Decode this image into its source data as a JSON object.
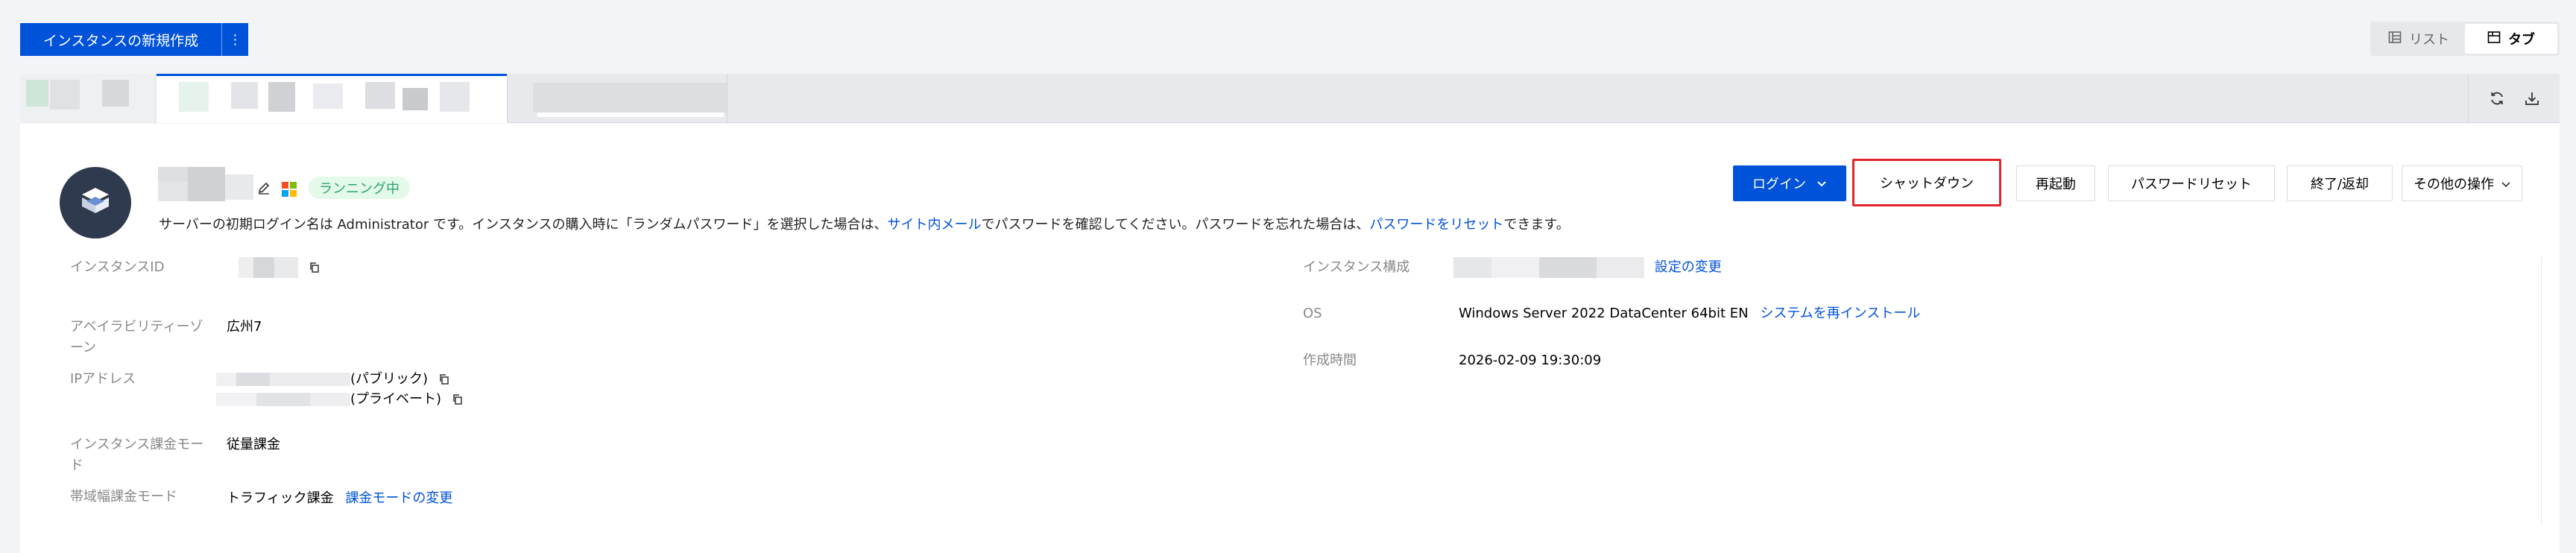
{
  "toolbar": {
    "create_label": "インスタンスの新規作成",
    "more_label": "⋮",
    "view_list_label": "リスト",
    "view_tab_label": "タブ"
  },
  "instance": {
    "status": "ランニング中",
    "notice": {
      "part1": "サーバーの初期ログイン名は Administrator です。インスタンスの購入時に「ランダムパスワード」を選択した場合は、",
      "link1": "サイト内メール",
      "part2": "でパスワードを確認してください。パスワードを忘れた場合は、",
      "link2": "パスワードをリセット",
      "part3": "できます。"
    }
  },
  "actions": {
    "login": "ログイン",
    "shutdown": "シャットダウン",
    "restart": "再起動",
    "reset_password": "パスワードリセット",
    "terminate": "終了/返却",
    "more": "その他の操作"
  },
  "details": {
    "instance_id_label": "インスタンスID",
    "zone_label": "アベイラビリティーゾーン",
    "zone_value": "広州7",
    "ip_label": "IPアドレス",
    "ip_public_suffix": "(パブリック)",
    "ip_private_suffix": "(プライベート)",
    "billing_label": "インスタンス課金モード",
    "billing_value": "従量課金",
    "bandwidth_label": "帯域幅課金モード",
    "bandwidth_value": "トラフィック課金",
    "bandwidth_link": "課金モードの変更",
    "config_label": "インスタンス構成",
    "config_link": "設定の変更",
    "os_label": "OS",
    "os_value": "Windows Server 2022 DataCenter 64bit EN",
    "os_link": "システムを再インストール",
    "created_label": "作成時間",
    "created_value": "2026-02-09 19:30:09"
  }
}
